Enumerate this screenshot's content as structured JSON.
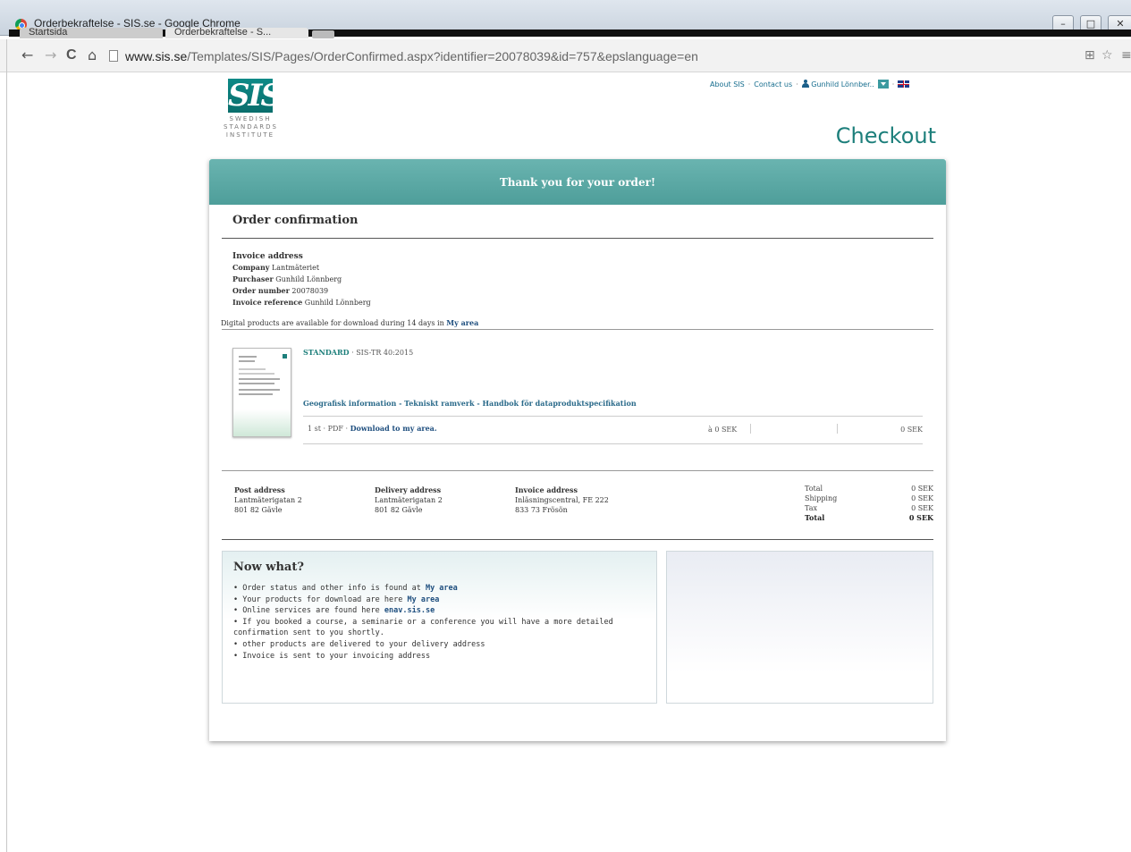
{
  "window": {
    "title": "Orderbekraftelse - SIS.se - Google Chrome"
  },
  "tabs": [
    {
      "label": "Startsida"
    },
    {
      "label": "Orderbekraftelse - S..."
    }
  ],
  "window_controls": {
    "minimize": "–",
    "maximize": "□",
    "close": "✕"
  },
  "browser": {
    "url_host": "www.sis.se",
    "url_path": "/Templates/SIS/Pages/OrderConfirmed.aspx?identifier=20078039&id=757&epslanguage=en",
    "nav": {
      "back": "←",
      "forward": "→",
      "reload": "C",
      "home": "⌂"
    },
    "right_icons": {
      "translate": "⊞",
      "star": "☆",
      "menu": "≡"
    }
  },
  "logo": {
    "mark": "SIS",
    "line1": "SWEDISH",
    "line2": "STANDARDS",
    "line3": "INSTITUTE"
  },
  "toplinks": {
    "about": "About SIS",
    "contact": "Contact us",
    "user": "Gunhild Lönnber.."
  },
  "page_title": "Checkout",
  "banner": "Thank you for your order!",
  "section_title": "Order confirmation",
  "invoice": {
    "heading": "Invoice address",
    "company_label": "Company",
    "company": "Lantmäteriet",
    "purchaser_label": "Purchaser",
    "purchaser": "Gunhild Lönnberg",
    "order_number_label": "Order number",
    "order_number": "20078039",
    "reference_label": "Invoice reference",
    "reference": "Gunhild Lönnberg"
  },
  "digital_note": {
    "text": "Digital products are available for download during 14 days in ",
    "link": "My area"
  },
  "product": {
    "type": "STANDARD",
    "code": "SIS-TR 40:2015",
    "name": "Geografisk information - Tekniskt ramverk - Handbok för dataproduktspecifikation",
    "qty_format": "1 st · PDF · ",
    "download_link": "Download to my area.",
    "unit_price": "à 0 SEK",
    "line_total": "0 SEK"
  },
  "addresses": [
    {
      "heading": "Post address",
      "line1": "Lantmäterigatan 2",
      "line2": "801 82 Gävle"
    },
    {
      "heading": "Delivery address",
      "line1": "Lantmäterigatan 2",
      "line2": "801 82 Gävle"
    },
    {
      "heading": "Invoice address",
      "line1": "Inläsningscentral, FE 222",
      "line2": "833 73 Frösön"
    }
  ],
  "totals": [
    {
      "label": "Total",
      "value": "0 SEK"
    },
    {
      "label": "Shipping",
      "value": "0 SEK"
    },
    {
      "label": "Tax",
      "value": "0 SEK"
    },
    {
      "label": "Total",
      "value": "0 SEK"
    }
  ],
  "now_what": {
    "title": "Now what?",
    "items": [
      {
        "text": "Order status and other info is found at ",
        "link": "My area"
      },
      {
        "text": "Your products for download are here ",
        "link": "My area"
      },
      {
        "text": "Online services are found here ",
        "link": "enav.sis.se"
      },
      {
        "text": "If you booked a course, a seminarie or a conference you will have a more detailed confirmation sent to you shortly.",
        "link": ""
      },
      {
        "text": "other products are delivered to your delivery address",
        "link": ""
      },
      {
        "text": "Invoice is sent to your invoicing address",
        "link": ""
      }
    ]
  },
  "colors": {
    "brand_teal": "#1d7f7b",
    "banner": "#5aa8a4",
    "link": "#1f4f7f"
  }
}
